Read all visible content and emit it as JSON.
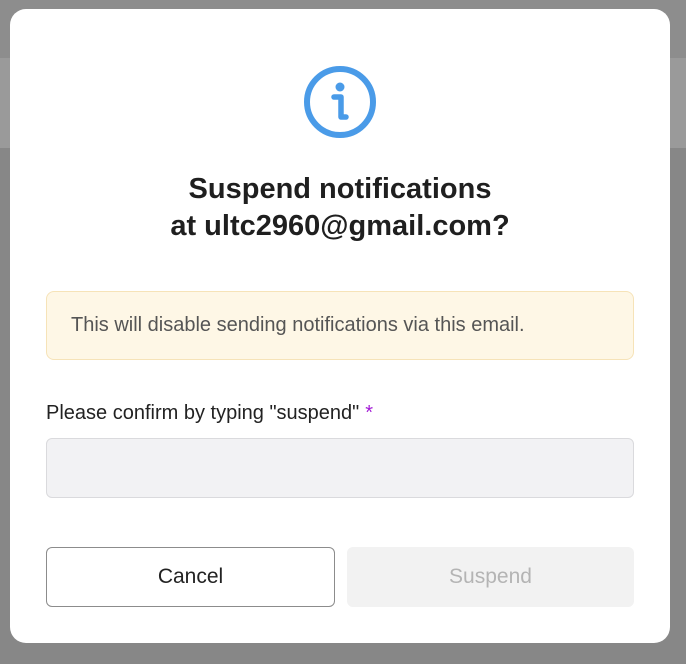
{
  "dialog": {
    "title_line1": "Suspend notifications",
    "title_line2": "at ultc2960@gmail.com?",
    "icon": "info-icon",
    "alert_text": "This will disable sending notifications via this email.",
    "confirm_label": "Please confirm by typing \"suspend\"",
    "required_marker": "*",
    "confirm_value": "",
    "confirm_placeholder": "",
    "cancel_label": "Cancel",
    "suspend_label": "Suspend"
  },
  "colors": {
    "icon_blue": "#4a9be8",
    "alert_background": "#fef7e6",
    "alert_border": "#f6e3b8",
    "required_marker": "#a31bd6",
    "disabled_text": "#b4b4b4"
  }
}
